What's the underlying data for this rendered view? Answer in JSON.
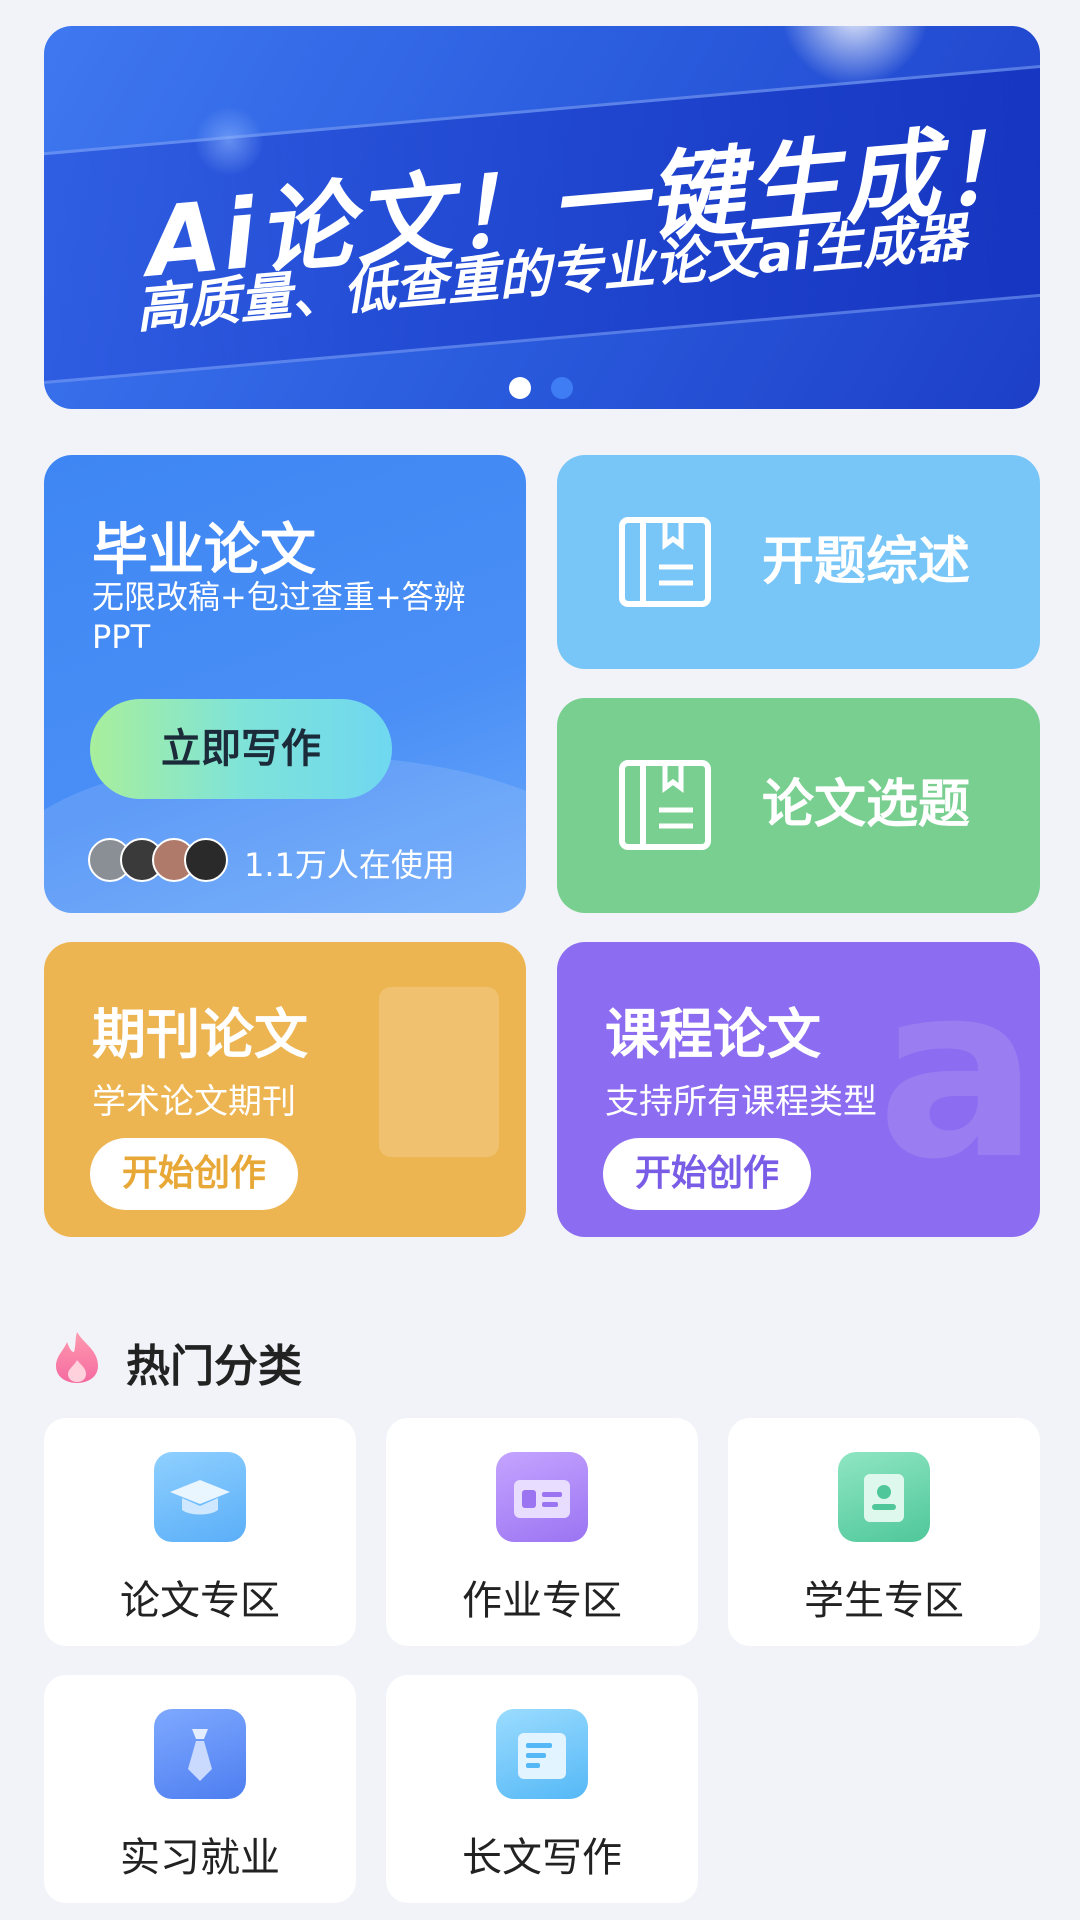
{
  "banner": {
    "headline": "Ai论文！一键生成！",
    "subline": "高质量、低查重的专业论文ai生成器",
    "dots": [
      {
        "active": true
      },
      {
        "active": false
      }
    ]
  },
  "graduation": {
    "title": "毕业论文",
    "subtitle": "无限改稿+包过查重+答辨PPT",
    "button": "立即写作",
    "users_text": "1.1万人在使用"
  },
  "proposal": {
    "label": "开题综述"
  },
  "topic": {
    "label": "论文选题"
  },
  "journal": {
    "title": "期刊论文",
    "subtitle": "学术论文期刊",
    "button": "开始创作"
  },
  "course": {
    "title": "课程论文",
    "subtitle": "支持所有课程类型",
    "button": "开始创作",
    "deco": "a"
  },
  "hot": {
    "title": "热门分类",
    "items": [
      {
        "label": "论文专区",
        "icon": "graduation-cap-icon",
        "color": "#6bbcfb"
      },
      {
        "label": "作业专区",
        "icon": "homework-card-icon",
        "color": "#a783f5"
      },
      {
        "label": "学生专区",
        "icon": "student-id-icon",
        "color": "#5fd3a3"
      },
      {
        "label": "实习就业",
        "icon": "necktie-icon",
        "color": "#5b8ef6"
      },
      {
        "label": "长文写作",
        "icon": "long-document-icon",
        "color": "#6cc8fb"
      }
    ]
  }
}
